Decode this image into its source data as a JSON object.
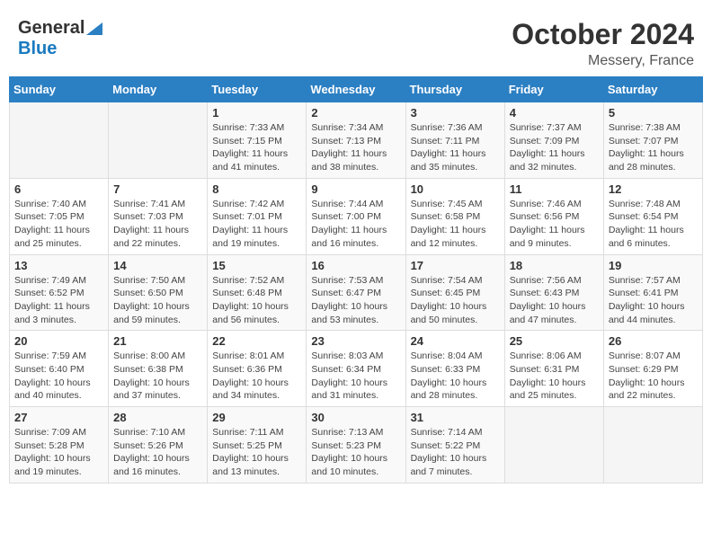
{
  "header": {
    "logo_general": "General",
    "logo_blue": "Blue",
    "month_year": "October 2024",
    "location": "Messery, France"
  },
  "calendar": {
    "days_of_week": [
      "Sunday",
      "Monday",
      "Tuesday",
      "Wednesday",
      "Thursday",
      "Friday",
      "Saturday"
    ],
    "weeks": [
      [
        {
          "day": "",
          "info": ""
        },
        {
          "day": "",
          "info": ""
        },
        {
          "day": "1",
          "info": "Sunrise: 7:33 AM\nSunset: 7:15 PM\nDaylight: 11 hours and 41 minutes."
        },
        {
          "day": "2",
          "info": "Sunrise: 7:34 AM\nSunset: 7:13 PM\nDaylight: 11 hours and 38 minutes."
        },
        {
          "day": "3",
          "info": "Sunrise: 7:36 AM\nSunset: 7:11 PM\nDaylight: 11 hours and 35 minutes."
        },
        {
          "day": "4",
          "info": "Sunrise: 7:37 AM\nSunset: 7:09 PM\nDaylight: 11 hours and 32 minutes."
        },
        {
          "day": "5",
          "info": "Sunrise: 7:38 AM\nSunset: 7:07 PM\nDaylight: 11 hours and 28 minutes."
        }
      ],
      [
        {
          "day": "6",
          "info": "Sunrise: 7:40 AM\nSunset: 7:05 PM\nDaylight: 11 hours and 25 minutes."
        },
        {
          "day": "7",
          "info": "Sunrise: 7:41 AM\nSunset: 7:03 PM\nDaylight: 11 hours and 22 minutes."
        },
        {
          "day": "8",
          "info": "Sunrise: 7:42 AM\nSunset: 7:01 PM\nDaylight: 11 hours and 19 minutes."
        },
        {
          "day": "9",
          "info": "Sunrise: 7:44 AM\nSunset: 7:00 PM\nDaylight: 11 hours and 16 minutes."
        },
        {
          "day": "10",
          "info": "Sunrise: 7:45 AM\nSunset: 6:58 PM\nDaylight: 11 hours and 12 minutes."
        },
        {
          "day": "11",
          "info": "Sunrise: 7:46 AM\nSunset: 6:56 PM\nDaylight: 11 hours and 9 minutes."
        },
        {
          "day": "12",
          "info": "Sunrise: 7:48 AM\nSunset: 6:54 PM\nDaylight: 11 hours and 6 minutes."
        }
      ],
      [
        {
          "day": "13",
          "info": "Sunrise: 7:49 AM\nSunset: 6:52 PM\nDaylight: 11 hours and 3 minutes."
        },
        {
          "day": "14",
          "info": "Sunrise: 7:50 AM\nSunset: 6:50 PM\nDaylight: 10 hours and 59 minutes."
        },
        {
          "day": "15",
          "info": "Sunrise: 7:52 AM\nSunset: 6:48 PM\nDaylight: 10 hours and 56 minutes."
        },
        {
          "day": "16",
          "info": "Sunrise: 7:53 AM\nSunset: 6:47 PM\nDaylight: 10 hours and 53 minutes."
        },
        {
          "day": "17",
          "info": "Sunrise: 7:54 AM\nSunset: 6:45 PM\nDaylight: 10 hours and 50 minutes."
        },
        {
          "day": "18",
          "info": "Sunrise: 7:56 AM\nSunset: 6:43 PM\nDaylight: 10 hours and 47 minutes."
        },
        {
          "day": "19",
          "info": "Sunrise: 7:57 AM\nSunset: 6:41 PM\nDaylight: 10 hours and 44 minutes."
        }
      ],
      [
        {
          "day": "20",
          "info": "Sunrise: 7:59 AM\nSunset: 6:40 PM\nDaylight: 10 hours and 40 minutes."
        },
        {
          "day": "21",
          "info": "Sunrise: 8:00 AM\nSunset: 6:38 PM\nDaylight: 10 hours and 37 minutes."
        },
        {
          "day": "22",
          "info": "Sunrise: 8:01 AM\nSunset: 6:36 PM\nDaylight: 10 hours and 34 minutes."
        },
        {
          "day": "23",
          "info": "Sunrise: 8:03 AM\nSunset: 6:34 PM\nDaylight: 10 hours and 31 minutes."
        },
        {
          "day": "24",
          "info": "Sunrise: 8:04 AM\nSunset: 6:33 PM\nDaylight: 10 hours and 28 minutes."
        },
        {
          "day": "25",
          "info": "Sunrise: 8:06 AM\nSunset: 6:31 PM\nDaylight: 10 hours and 25 minutes."
        },
        {
          "day": "26",
          "info": "Sunrise: 8:07 AM\nSunset: 6:29 PM\nDaylight: 10 hours and 22 minutes."
        }
      ],
      [
        {
          "day": "27",
          "info": "Sunrise: 7:09 AM\nSunset: 5:28 PM\nDaylight: 10 hours and 19 minutes."
        },
        {
          "day": "28",
          "info": "Sunrise: 7:10 AM\nSunset: 5:26 PM\nDaylight: 10 hours and 16 minutes."
        },
        {
          "day": "29",
          "info": "Sunrise: 7:11 AM\nSunset: 5:25 PM\nDaylight: 10 hours and 13 minutes."
        },
        {
          "day": "30",
          "info": "Sunrise: 7:13 AM\nSunset: 5:23 PM\nDaylight: 10 hours and 10 minutes."
        },
        {
          "day": "31",
          "info": "Sunrise: 7:14 AM\nSunset: 5:22 PM\nDaylight: 10 hours and 7 minutes."
        },
        {
          "day": "",
          "info": ""
        },
        {
          "day": "",
          "info": ""
        }
      ]
    ]
  }
}
